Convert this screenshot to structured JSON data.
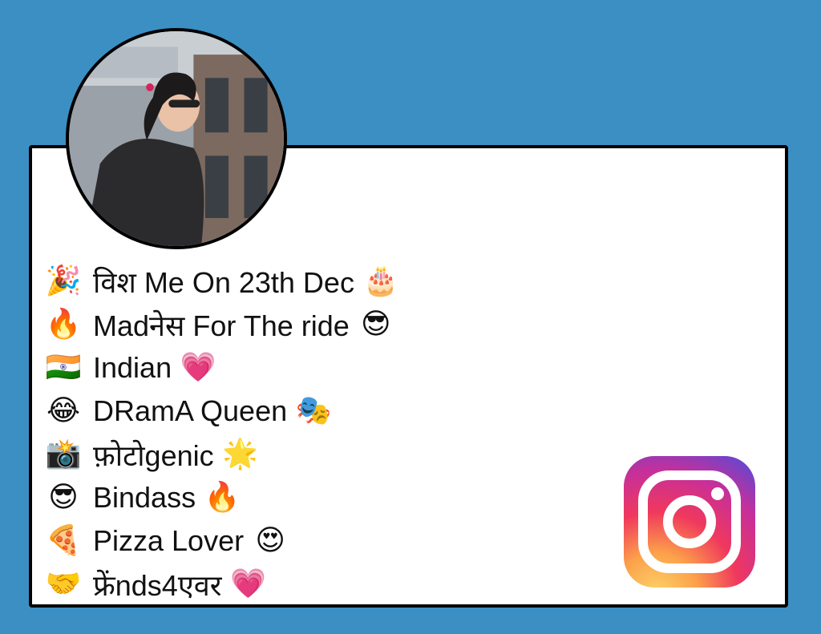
{
  "profile": {
    "avatar_icon": "profile-photo"
  },
  "bio": [
    {
      "lead_emoji": "🎉",
      "text": "विश Me On 23th Dec",
      "trail_emoji": "🎂"
    },
    {
      "lead_emoji": "🔥",
      "text": "Madनेस For The ride",
      "trail_emoji": "😎"
    },
    {
      "lead_emoji": "🇮🇳",
      "text": "Indian",
      "trail_emoji": "💗"
    },
    {
      "lead_emoji": "😂",
      "text": "DRamA Queen",
      "trail_emoji": "🎭"
    },
    {
      "lead_emoji": "📸",
      "text": "फ़ोटोgenic",
      "trail_emoji": "🌟"
    },
    {
      "lead_emoji": "😎",
      "text": "Bindass",
      "trail_emoji": "🔥"
    },
    {
      "lead_emoji": "🍕",
      "text": "Pizza Lover",
      "trail_emoji": "😍"
    },
    {
      "lead_emoji": "🤝",
      "text": "फ्रेंnds4एवर",
      "trail_emoji": "💗"
    }
  ],
  "colors": {
    "background": "#3b8fc3",
    "card": "#ffffff",
    "border": "#000000"
  },
  "logo": {
    "icon": "instagram-logo-icon"
  }
}
